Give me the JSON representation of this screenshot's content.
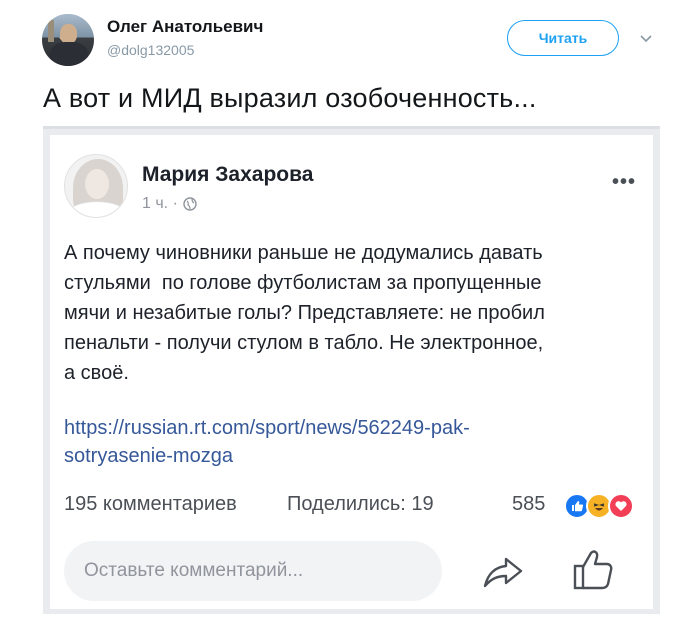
{
  "tweet": {
    "author_name": "Олег Анатольевич",
    "author_handle": "@dolg132005",
    "follow_label": "Читать",
    "text": "А вот и МИД выразил озобоченность..."
  },
  "embed": {
    "author_name": "Мария Захарова",
    "time": "1 ч. ·",
    "more": "•••",
    "body_lines": [
      "А почему чиновники раньше не додумались давать",
      "стульями  по голове футболистам за пропущенные",
      "мячи и незабитые голы? Представляете: не пробил",
      "пенальти - получи стулом в табло. Не электронное,",
      "а своё."
    ],
    "link_lines": [
      "https://russian.rt.com/sport/news/562249-pak-",
      "sotryasenie-mozga"
    ],
    "comments": "195 комментариев",
    "shares": "Поделились: 19",
    "reactions_count": "585",
    "comment_placeholder": "Оставьте комментарий..."
  },
  "colors": {
    "twitter_blue": "#1da1f2",
    "fb_link": "#365899",
    "muted": "#90949c"
  },
  "icons": [
    "chevron-down-icon",
    "globe-icon",
    "more-icon",
    "like-reaction-icon",
    "haha-reaction-icon",
    "love-reaction-icon",
    "share-icon",
    "thumbs-up-icon"
  ]
}
